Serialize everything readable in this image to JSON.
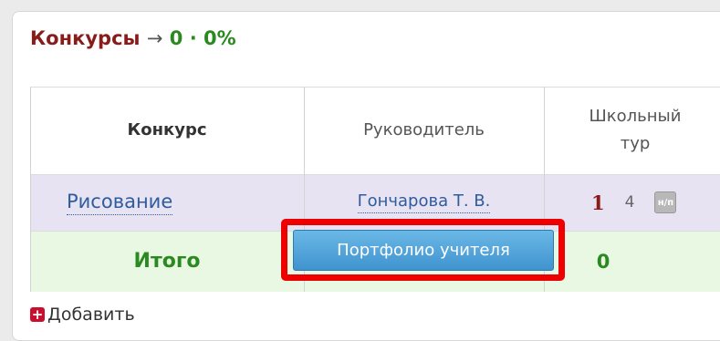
{
  "section": {
    "title": "Конкурсы",
    "arrow": "→",
    "count": "0",
    "separator": "·",
    "percent": "0%"
  },
  "table": {
    "columns": [
      "Конкурс",
      "Руководитель",
      "Школьный тур"
    ],
    "rows": [
      {
        "contest": "Рисование",
        "supervisor": "Гончарова Т. В.",
        "school_round_main": "1",
        "school_round_sub": "4",
        "action_icon": "н/п"
      }
    ],
    "total": {
      "label": "Итого",
      "school_round": "0"
    }
  },
  "portfolio_button": {
    "label": "Портфолио учителя"
  },
  "add_link": {
    "label": "Добавить",
    "icon": "plus-icon"
  },
  "colors": {
    "title_red": "#8a1b1b",
    "stat_green": "#2b8a1f",
    "link_blue": "#2e5c9c",
    "row_lavender": "#e8e3f3",
    "row_green": "#e9f8e3",
    "button_blue": "#4a9fd8",
    "highlight_red": "#ee0000"
  }
}
